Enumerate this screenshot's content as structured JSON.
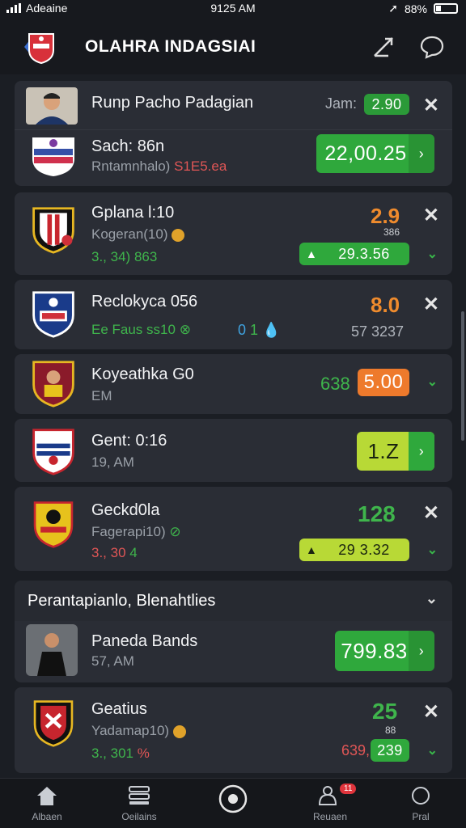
{
  "status": {
    "carrier": "Adeaine",
    "time": "9125 AM",
    "battery": "88%"
  },
  "header": {
    "title": "OLAHRA INDAGSIAI"
  },
  "cards": [
    {
      "name": "Runp Pacho Padagian",
      "label": "Jam:",
      "odds_small": "2.90",
      "sub_title": "Sach: 86n",
      "sub_detail_a": "Rntamnhalo)",
      "sub_detail_b": "S1E5.ea",
      "odds": "22,00.25"
    },
    {
      "name": "Gplana l:10",
      "sub": "Kogeran(10)",
      "meta_a": "3., 34)",
      "meta_b": "863",
      "odds_top": "2.9",
      "odds_top_sub": "386",
      "odds": "29.3.56"
    },
    {
      "name": "Reclokyca 056",
      "sub_a": "Ee Faus",
      "sub_b": "ss10",
      "meta_a": "0",
      "meta_b": "1",
      "odds_top": "8.0",
      "odds_sub": "57 3237"
    },
    {
      "name": "Koyeathka G0",
      "sub": "EM",
      "odds_left": "638",
      "odds": "5.00"
    },
    {
      "name": "Gent: 0:16",
      "sub": "19, AM",
      "odds": "1.Z"
    },
    {
      "name": "Geckd0la",
      "sub": "Fagerapi10)",
      "meta_a": "3., 30",
      "meta_b": "4",
      "odds_top": "128",
      "odds": "29 3.32"
    }
  ],
  "section": {
    "title": "Perantapianlo, Blenahtlies"
  },
  "cards2": [
    {
      "name": "Paneda Bands",
      "sub": "57, AM",
      "odds": "799.83"
    },
    {
      "name": "Geatius",
      "sub": "Yadamap10)",
      "meta_a": "3., 301",
      "meta_b": "%",
      "odds_top": "25",
      "odds_top_sub": "88",
      "odds_left": "639,",
      "odds": "239"
    }
  ],
  "tabs": [
    {
      "label": "Albaen",
      "icon": "home-icon"
    },
    {
      "label": "Oeilains",
      "icon": "list-icon"
    },
    {
      "label": "",
      "icon": "record-icon"
    },
    {
      "label": "Reuaen",
      "icon": "people-icon",
      "badge": "11"
    },
    {
      "label": "Pral",
      "icon": "circle-icon"
    }
  ]
}
